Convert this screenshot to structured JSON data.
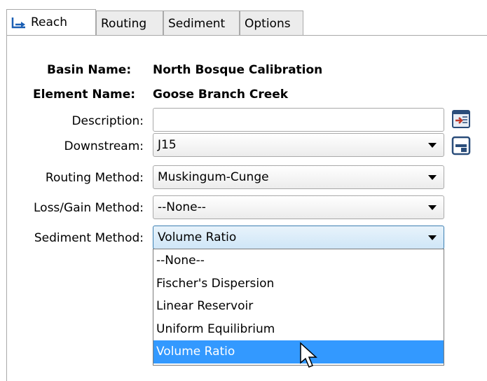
{
  "tabs": [
    {
      "label": "Reach",
      "icon": "reach-icon",
      "active": true
    },
    {
      "label": "Routing",
      "active": false
    },
    {
      "label": "Sediment",
      "active": false
    },
    {
      "label": "Options",
      "active": false
    }
  ],
  "header": {
    "basin_label": "Basin Name:",
    "basin_value": "North Bosque Calibration",
    "element_label": "Element Name:",
    "element_value": "Goose Branch Creek"
  },
  "fields": {
    "description": {
      "label": "Description:",
      "value": ""
    },
    "downstream": {
      "label": "Downstream:",
      "value": "J15"
    },
    "routing_method": {
      "label": "Routing Method:",
      "value": "Muskingum-Cunge"
    },
    "loss_gain_method": {
      "label": "Loss/Gain Method:",
      "value": "--None--"
    },
    "sediment_method": {
      "label": "Sediment Method:",
      "value": "Volume Ratio"
    }
  },
  "sediment_options": [
    "--None--",
    "Fischer's Dispersion",
    "Linear Reservoir",
    "Uniform Equilibrium",
    "Volume Ratio"
  ],
  "colors": {
    "selection": "#3399ff",
    "tab_bg": "#ececec",
    "border": "#a9a9a9"
  },
  "side_buttons": {
    "description_icon": "description-editor-icon",
    "downstream_icon": "select-element-icon"
  }
}
